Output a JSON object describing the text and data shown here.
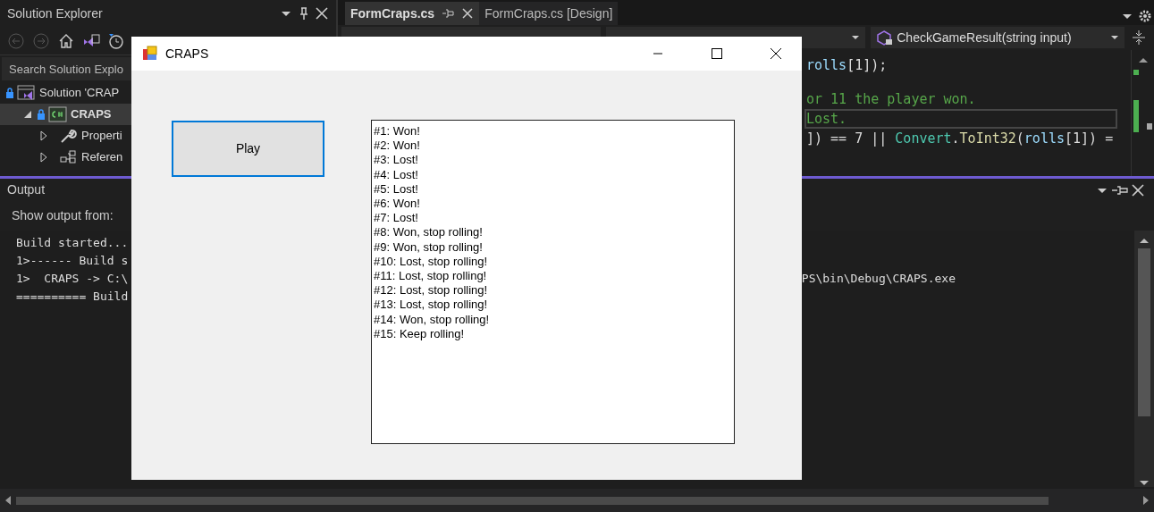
{
  "solution_explorer": {
    "title": "Solution Explorer",
    "search": {
      "placeholder": "Search Solution Explo"
    },
    "tree": [
      {
        "label": "Solution 'CRAP",
        "kind": "solution",
        "selected": false,
        "children": [
          {
            "label": "CRAPS",
            "kind": "project",
            "selected": true,
            "expanded": true,
            "children": [
              {
                "label": "Properti",
                "kind": "properties",
                "selected": false,
                "expanded": false
              },
              {
                "label": "Referen",
                "kind": "references",
                "selected": false,
                "expanded": false
              }
            ]
          }
        ]
      }
    ]
  },
  "editor": {
    "tabs": [
      {
        "label": "FormCraps.cs",
        "selected": true
      },
      {
        "label": "FormCraps.cs [Design]",
        "selected": false
      }
    ],
    "member_dropdown": {
      "label": "CheckGameResult(string input)"
    },
    "code_lines": [
      {
        "current": false,
        "tokens": [
          {
            "kind": "variable",
            "text": "rolls"
          },
          {
            "kind": "plain",
            "text": "[1]);"
          }
        ]
      },
      {
        "current": false,
        "tokens": [
          {
            "kind": "comment",
            "text": "or 11 the player won."
          }
        ]
      },
      {
        "current": true,
        "tokens": [
          {
            "kind": "comment",
            "text": "Lost."
          }
        ]
      },
      {
        "current": false,
        "tokens": [
          {
            "kind": "plain",
            "text": "]) == 7 || "
          },
          {
            "kind": "type",
            "text": "Convert"
          },
          {
            "kind": "plain",
            "text": "."
          },
          {
            "kind": "method",
            "text": "ToInt32"
          },
          {
            "kind": "plain",
            "text": "("
          },
          {
            "kind": "variable",
            "text": "rolls"
          },
          {
            "kind": "plain",
            "text": "[1]) ="
          }
        ]
      }
    ]
  },
  "output": {
    "title": "Output",
    "source_label": "Show output from:",
    "lines": [
      {
        "text": "Build started..."
      },
      {
        "text": "1>------ Build s"
      },
      {
        "text": "1>  CRAPS -> C:\\",
        "continued": "PS\\bin\\Debug\\CRAPS.exe"
      },
      {
        "text": "========== Build"
      }
    ]
  },
  "form": {
    "title": "CRAPS",
    "button": "Play",
    "results": [
      "#1: Won!",
      "#2: Won!",
      "#3: Lost!",
      "#4: Lost!",
      "#5: Lost!",
      "#6: Won!",
      "#7: Lost!",
      "#8: Won, stop rolling!",
      "#9: Won, stop rolling!",
      "#10: Lost, stop rolling!",
      "#11: Lost, stop rolling!",
      "#12: Lost, stop rolling!",
      "#13: Lost, stop rolling!",
      "#14: Won, stop rolling!",
      "#15: Keep rolling!"
    ]
  }
}
